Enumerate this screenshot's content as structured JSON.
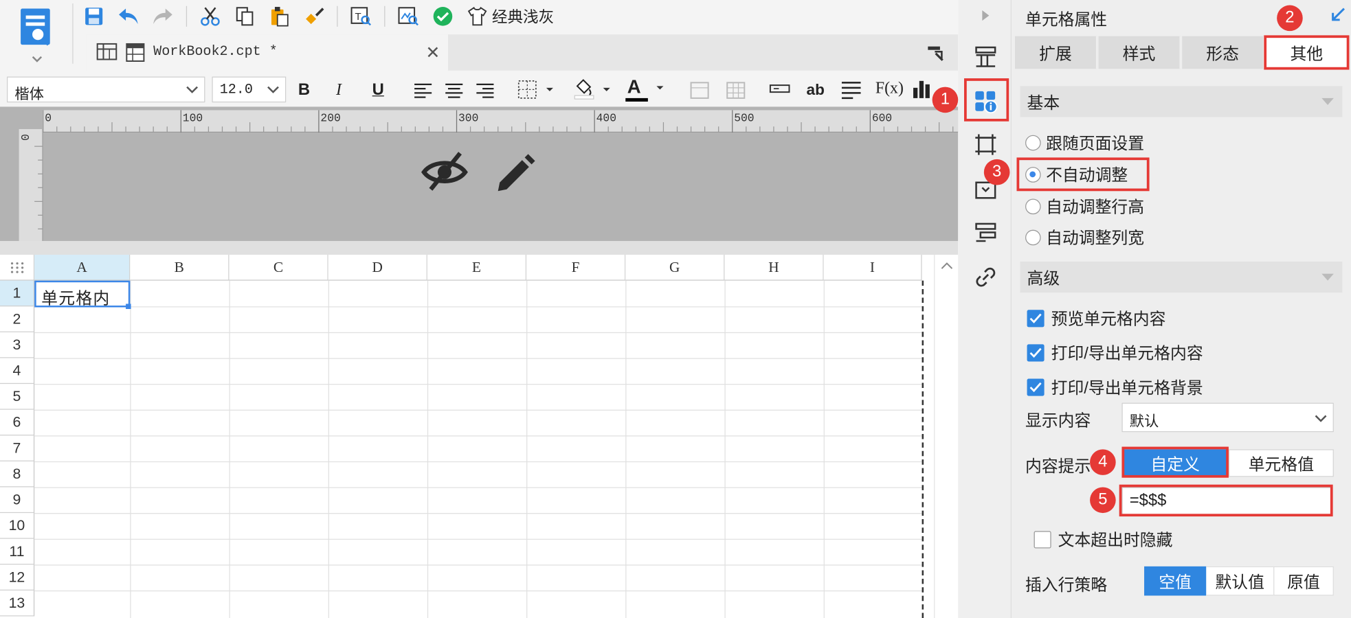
{
  "toolbar": {
    "theme_label": "经典浅灰",
    "icons": [
      "template-icon",
      "save-icon",
      "undo-icon",
      "redo-icon",
      "cut-icon",
      "copy-icon",
      "paste-icon",
      "format-painter-icon",
      "text-search-icon",
      "preview-icon",
      "check-icon",
      "shirt-icon"
    ]
  },
  "tab": {
    "title": "WorkBook2.cpt *",
    "close": "✕"
  },
  "format_bar": {
    "font": "楷体",
    "size": "12.0",
    "bold": "B",
    "italic": "I",
    "underline": "U",
    "text_sample": "ab",
    "formula": "F(x)",
    "font_color_letter": "A"
  },
  "ruler": {
    "ticks": [
      "0",
      "100",
      "200",
      "300",
      "400",
      "500",
      "600"
    ],
    "vertical_zero": "0"
  },
  "grid": {
    "columns": [
      "A",
      "B",
      "C",
      "D",
      "E",
      "F",
      "G",
      "H",
      "I"
    ],
    "rows": [
      "1",
      "2",
      "3",
      "4",
      "5",
      "6",
      "7",
      "8",
      "9",
      "10",
      "11",
      "12",
      "13"
    ],
    "cell_a1": "单元格内"
  },
  "panel": {
    "title": "单元格属性",
    "tabs": [
      "扩展",
      "样式",
      "形态",
      "其他"
    ],
    "active_tab": "其他",
    "basic": {
      "header": "基本",
      "options": [
        "跟随页面设置",
        "不自动调整",
        "自动调整行高",
        "自动调整列宽"
      ],
      "selected": "不自动调整"
    },
    "advanced": {
      "header": "高级",
      "checks": [
        "预览单元格内容",
        "打印/导出单元格内容",
        "打印/导出单元格背景"
      ],
      "display_label": "显示内容",
      "display_value": "默认",
      "tooltip_label": "内容提示",
      "tooltip_custom": "自定义",
      "tooltip_cellvalue": "单元格值",
      "formula": "=$$$",
      "hide_overflow": "文本超出时隐藏",
      "insert_label": "插入行策略",
      "insert_options": [
        "空值",
        "默认值",
        "原值"
      ]
    }
  },
  "annotations": [
    "1",
    "2",
    "3",
    "4",
    "5"
  ],
  "colors": {
    "accent": "#2f86e0",
    "highlight": "#e53935"
  }
}
